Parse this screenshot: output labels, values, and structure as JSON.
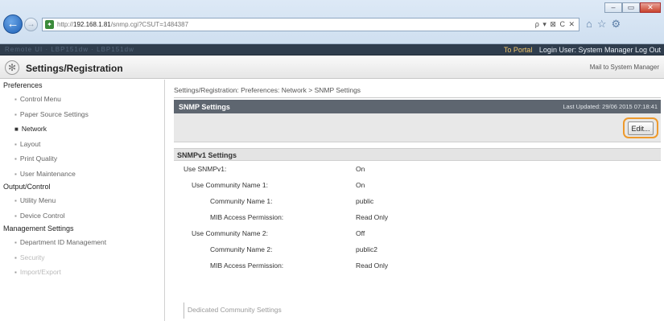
{
  "browser": {
    "window_controls": [
      "–",
      "▭",
      "✕"
    ],
    "url_prefix": "http://",
    "url_host": "192.168.1.81",
    "url_rest": "/snmp.cgi?CSUT=1484387",
    "address_tools": "ρ ▾ ⊠ C ✕",
    "back_glyph": "←",
    "forward_glyph": "→",
    "icons": [
      "home-icon",
      "star-icon",
      "gear-icon"
    ]
  },
  "topbar": {
    "ghost_text": "Remote UI · LBP151dw · LBP151dw",
    "portal_link": "To Portal",
    "login_text": "Login User: System Manager Log Out"
  },
  "header": {
    "title": "Settings/Registration",
    "mail_link": "Mail to System Manager"
  },
  "sidebar": {
    "categories": [
      {
        "label": "Preferences",
        "items": [
          {
            "label": "Control Menu",
            "active": false
          },
          {
            "label": "Paper Source Settings",
            "active": false
          },
          {
            "label": "Network",
            "active": true
          },
          {
            "label": "Layout",
            "active": false
          },
          {
            "label": "Print Quality",
            "active": false
          },
          {
            "label": "User Maintenance",
            "active": false
          }
        ]
      },
      {
        "label": "Output/Control",
        "items": [
          {
            "label": "Utility Menu",
            "active": false
          },
          {
            "label": "Device Control",
            "active": false
          }
        ]
      },
      {
        "label": "Management Settings",
        "items": [
          {
            "label": "Department ID Management",
            "active": false
          },
          {
            "label": "Security",
            "active": false
          },
          {
            "label": "Import/Export",
            "active": false
          }
        ]
      }
    ]
  },
  "main": {
    "breadcrumb": "Settings/Registration: Preferences: Network > SNMP Settings",
    "panel_title": "SNMP Settings",
    "last_updated": "Last Updated: 29/06 2015 07:18:41",
    "edit_label": "Edit...",
    "section_title": "SNMPv1 Settings",
    "rows": [
      {
        "label": "Use SNMPv1:",
        "value": "On",
        "level": 0
      },
      {
        "label": "Use Community Name 1:",
        "value": "On",
        "level": 1
      },
      {
        "label": "Community Name 1:",
        "value": "public",
        "level": 2
      },
      {
        "label": "MIB Access Permission:",
        "value": "Read Only",
        "level": 2
      },
      {
        "label": "Use Community Name 2:",
        "value": "Off",
        "level": 1
      },
      {
        "label": "Community Name 2:",
        "value": "public2",
        "level": 2
      },
      {
        "label": "MIB Access Permission:",
        "value": "Read Only",
        "level": 2
      }
    ],
    "dedicated_label": "Dedicated Community Settings"
  },
  "colors": {
    "accent_orange": "#ee9a2d",
    "panel_head": "#5e6670",
    "topbar": "#2f3d4d",
    "portal_link": "#f3c76b"
  }
}
